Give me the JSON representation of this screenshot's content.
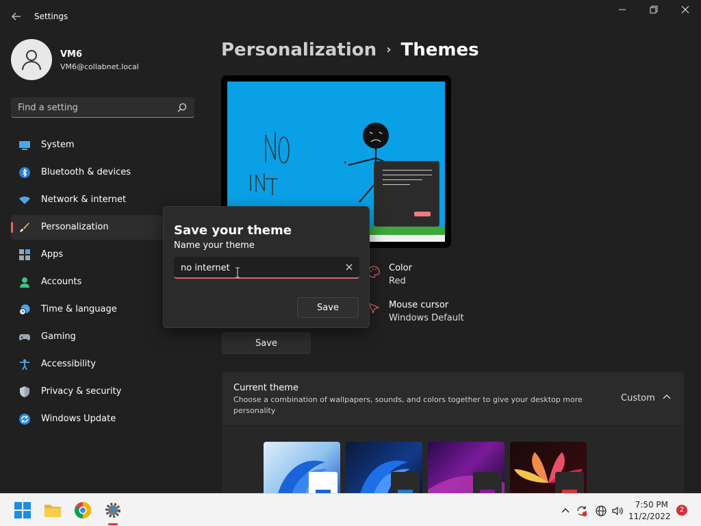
{
  "window": {
    "app_title": "Settings",
    "back_icon": "back-arrow-icon",
    "minimize_icon": "minimize-icon",
    "maximize_icon": "restore-icon",
    "close_icon": "close-icon"
  },
  "user": {
    "name": "VM6",
    "email": "VM6@collabnet.local"
  },
  "search": {
    "placeholder": "Find a setting"
  },
  "sidebar": {
    "items": [
      {
        "label": "System",
        "icon": "monitor-icon"
      },
      {
        "label": "Bluetooth & devices",
        "icon": "bluetooth-icon"
      },
      {
        "label": "Network & internet",
        "icon": "wifi-icon"
      },
      {
        "label": "Personalization",
        "icon": "brush-icon",
        "active": true
      },
      {
        "label": "Apps",
        "icon": "apps-icon"
      },
      {
        "label": "Accounts",
        "icon": "person-icon"
      },
      {
        "label": "Time & language",
        "icon": "clock-globe-icon"
      },
      {
        "label": "Gaming",
        "icon": "gamepad-icon"
      },
      {
        "label": "Accessibility",
        "icon": "accessibility-icon"
      },
      {
        "label": "Privacy & security",
        "icon": "shield-icon"
      },
      {
        "label": "Windows Update",
        "icon": "update-icon"
      }
    ]
  },
  "breadcrumb": {
    "parent": "Personalization",
    "separator": "›",
    "current": "Themes"
  },
  "properties": {
    "color": {
      "title": "Color",
      "value": "Red"
    },
    "cursor": {
      "title": "Mouse cursor",
      "value": "Windows Default"
    }
  },
  "save_button": "Save",
  "current_theme": {
    "title": "Current theme",
    "description": "Choose a combination of wallpapers, sounds, and colors together to give your desktop more personality",
    "value": "Custom"
  },
  "dialog": {
    "title": "Save your theme",
    "label": "Name your theme",
    "input_value": "no internet",
    "save_label": "Save"
  },
  "taskbar": {
    "time": "7:50 PM",
    "date": "11/2/2022",
    "notification_count": "2"
  },
  "colors": {
    "accent": "#e0656a",
    "background": "#202020",
    "preview_sky": "#0aa0e6"
  }
}
